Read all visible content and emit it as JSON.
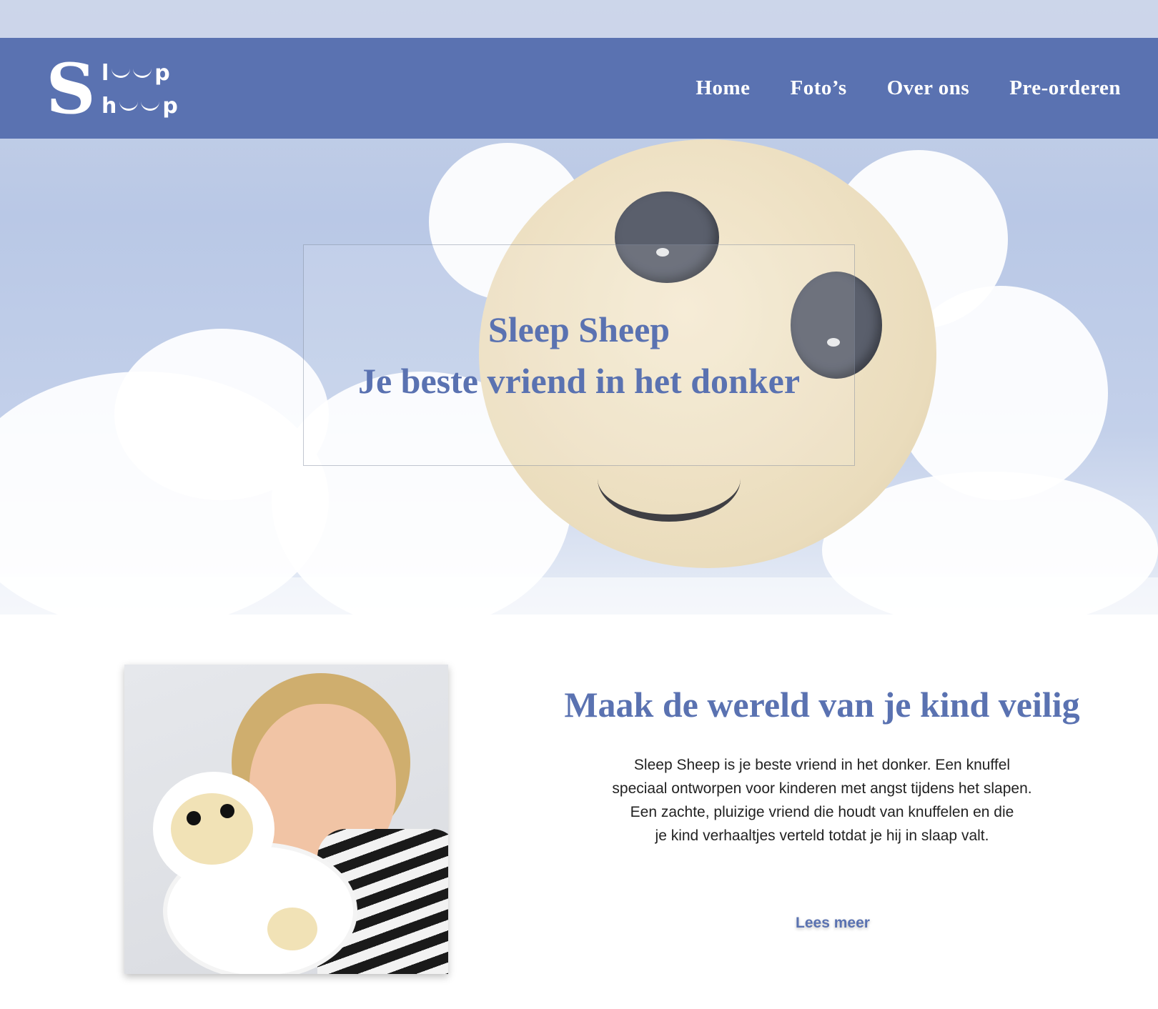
{
  "logo": {
    "letter": "S",
    "row1": [
      "l",
      "p"
    ],
    "row2": [
      "h",
      "p"
    ]
  },
  "nav": {
    "items": [
      "Home",
      "Foto’s",
      "Over ons",
      "Pre-orderen"
    ]
  },
  "hero": {
    "title": "Sleep Sheep",
    "subtitle": "Je beste vriend in het donker"
  },
  "content": {
    "heading": "Maak de wereld van je kind veilig",
    "body": [
      "Sleep Sheep is je beste vriend in het donker. Een knuffel",
      "speciaal ontworpen voor kinderen met angst tijdens het slapen.",
      "Een zachte, pluizige vriend die houdt van knuffelen en die",
      "je kind verhaaltjes verteld totdat je hij in slaap valt."
    ],
    "read_more": "Lees meer"
  },
  "colors": {
    "brand": "#5a72b1",
    "text": "#222222",
    "background": "#ffffff"
  }
}
